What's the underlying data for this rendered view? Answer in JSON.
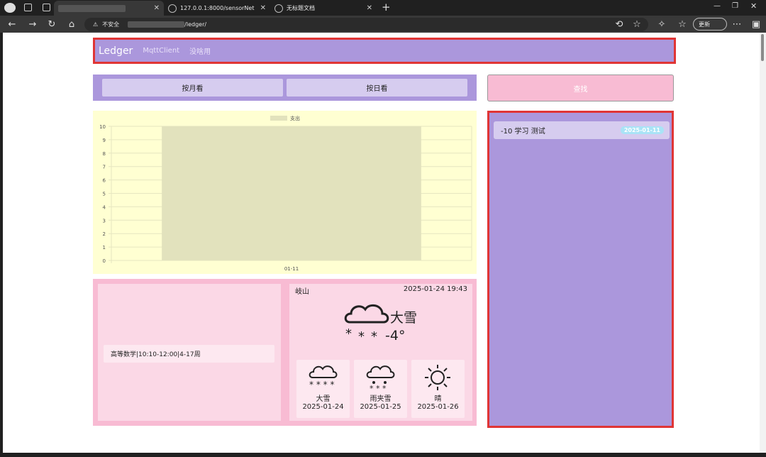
{
  "browser": {
    "tabs": [
      {
        "title": "",
        "close": "✕"
      },
      {
        "title": "127.0.0.1:8000/sensorNet",
        "close": "✕"
      },
      {
        "title": "无标题文档",
        "close": "✕"
      }
    ],
    "new_tab": "+",
    "security": "不安全",
    "url": "/ledger/",
    "update_label": "更新"
  },
  "navbar": {
    "brand": "Ledger",
    "links": [
      "MqttClient",
      "没啥用"
    ]
  },
  "view_buttons": {
    "month": "按月看",
    "day": "按日看"
  },
  "search_button": "查找",
  "chart_data": {
    "type": "bar",
    "categories": [
      "01-11"
    ],
    "series": [
      {
        "name": "支出",
        "values": [
          10
        ]
      }
    ],
    "ylim": [
      0,
      10
    ],
    "yticks": [
      "0",
      "1",
      "2",
      "3",
      "4",
      "5",
      "6",
      "7",
      "8",
      "9",
      "10"
    ],
    "grid": true,
    "legend": "top",
    "colors": {
      "bar": "#e2e2bd",
      "bg": "#ffffd2",
      "grid": "#e6e6c0"
    }
  },
  "course": "高等数学|10:10-12:00|4-17周",
  "weather": {
    "city": "岐山",
    "time": "2025-01-24 19:43",
    "current_desc": "大雪",
    "current_temp": "-4°",
    "current_icon": "snow-cloud-icon",
    "forecast": [
      {
        "desc": "大雪",
        "date": "2025-01-24",
        "icon": "snow-cloud-icon"
      },
      {
        "desc": "雨夹雪",
        "date": "2025-01-25",
        "icon": "sleet-cloud-icon"
      },
      {
        "desc": "晴",
        "date": "2025-01-26",
        "icon": "sun-icon"
      }
    ]
  },
  "records": [
    {
      "text": "-10 学习 测试",
      "date": "2025-01-11"
    }
  ],
  "colors": {
    "purple": "#ab97dc",
    "pink": "#f8bbd3",
    "highlight": "#e03535"
  }
}
